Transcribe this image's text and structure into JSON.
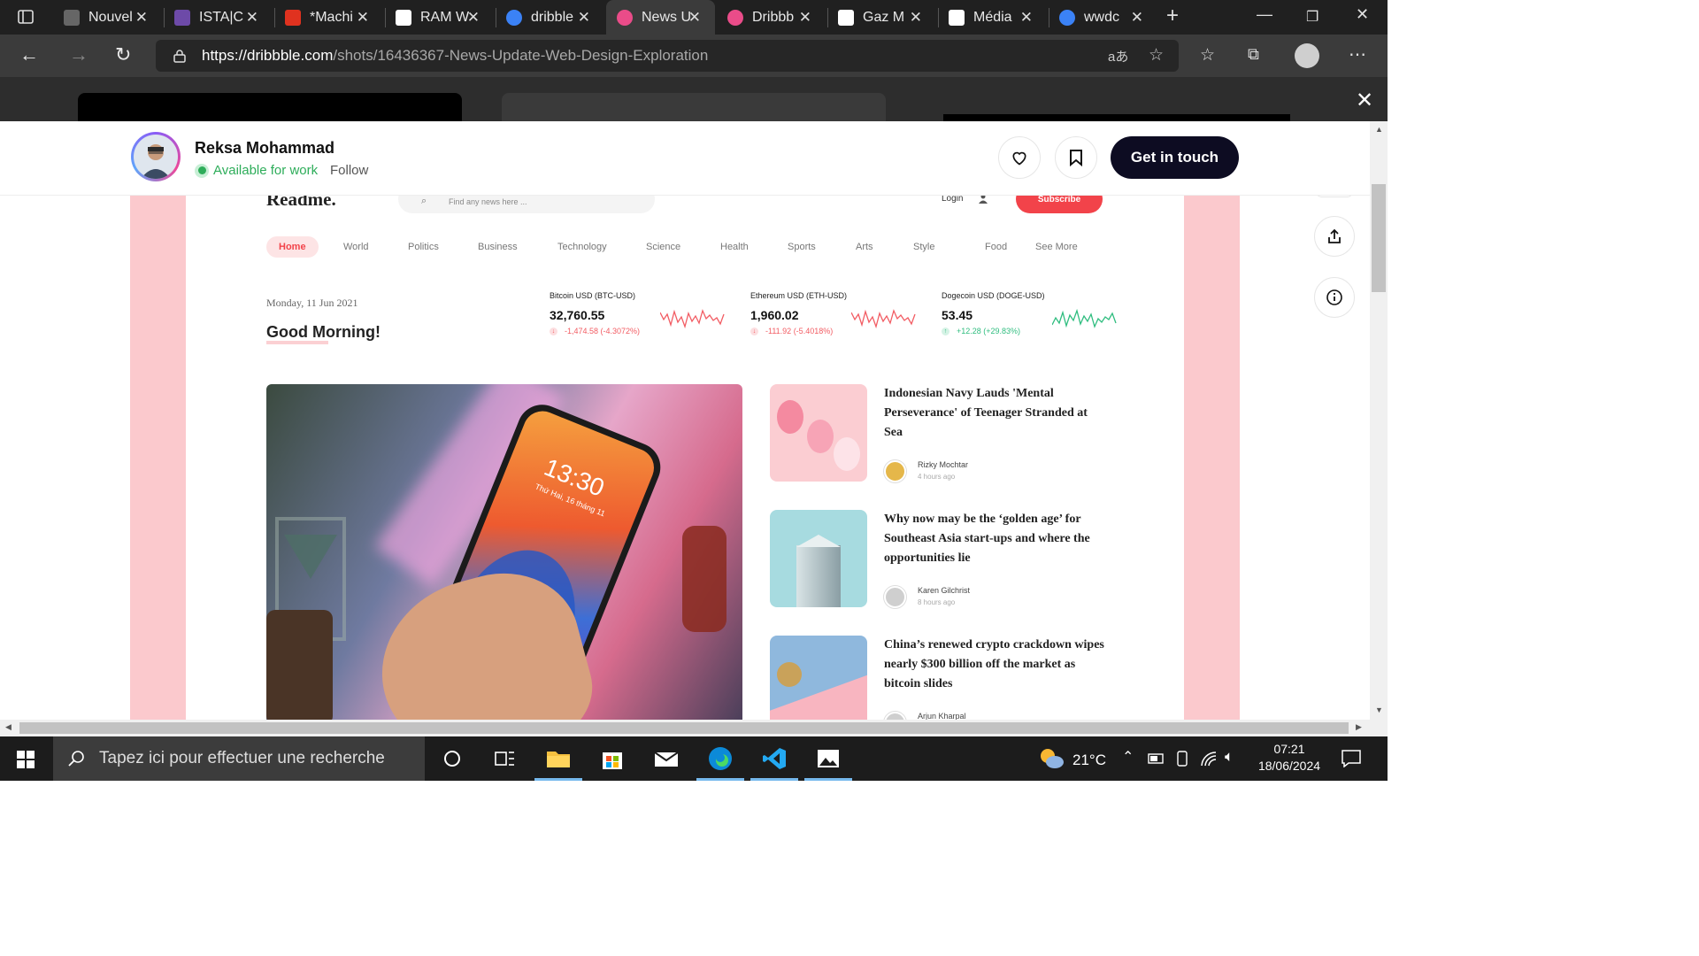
{
  "browser": {
    "tabs": [
      {
        "title": "Nouvel",
        "icon_color": "#666666",
        "icon": "new-tab-icon"
      },
      {
        "title": "ISTA|C",
        "icon_color": "#6d4aa8",
        "icon": "ista-icon"
      },
      {
        "title": "*Machi",
        "icon_color": "#e0321f",
        "icon": "pdf-icon"
      },
      {
        "title": "RAM W",
        "icon_color": "#ffffff",
        "icon": "ram-icon"
      },
      {
        "title": "dribble",
        "icon_color": "#3b82f6",
        "icon": "search-icon"
      },
      {
        "title": "News U",
        "icon_color": "#ea4c89",
        "icon": "dribbble-icon",
        "active": true
      },
      {
        "title": "Dribbb",
        "icon_color": "#ea4c89",
        "icon": "dribbble-icon"
      },
      {
        "title": "Gaz M",
        "icon_color": "#ffffff",
        "icon": "eye-icon"
      },
      {
        "title": "Média",
        "icon_color": "#ffffff",
        "icon": "eye-icon"
      },
      {
        "title": "wwdc",
        "icon_color": "#3b82f6",
        "icon": "search-icon"
      }
    ],
    "url_domain": "https://dribbble.com",
    "url_path": "/shots/16436367-News-Update-Web-Design-Exploration",
    "translate_glyph": "aあ"
  },
  "designer": {
    "name": "Reksa Mohammad",
    "availability": "Available for work",
    "follow": "Follow",
    "cta": "Get in touch"
  },
  "shot": {
    "logo": "Readme.",
    "search_placeholder": "Find any news here ...",
    "login": "Login",
    "subscribe": "Subscribe",
    "categories": [
      "Home",
      "World",
      "Politics",
      "Business",
      "Technology",
      "Science",
      "Health",
      "Sports",
      "Arts",
      "Style",
      "Food",
      "See More"
    ],
    "date": "Monday, 11 Jun 2021",
    "greeting": "Good Morning!",
    "crypto": [
      {
        "name": "Bitcoin USD (BTC-USD)",
        "price": "32,760.55",
        "change": "-1,474.58 (-4.3072%)",
        "trend": "down"
      },
      {
        "name": "Ethereum USD (ETH-USD)",
        "price": "1,960.02",
        "change": "-111.92 (-5.4018%)",
        "trend": "down"
      },
      {
        "name": "Dogecoin USD (DOGE-USD)",
        "price": "53.45",
        "change": "+12.28 (+29.83%)",
        "trend": "up"
      }
    ],
    "phone_time": "13:30",
    "phone_date": "Thứ Hai, 16 tháng 11",
    "articles": [
      {
        "title": "Indonesian Navy Lauds 'Mental Perseverance' of Teenager Stranded at Sea",
        "author": "Rizky Mochtar",
        "ago": "4 hours ago"
      },
      {
        "title": "Why now may be the ‘golden age’ for Southeast Asia start-ups and where the opportunities lie",
        "author": "Karen Gilchrist",
        "ago": "8 hours ago"
      },
      {
        "title": "China’s renewed crypto crackdown wipes nearly $300 billion off the market as bitcoin slides",
        "author": "Arjun Kharpal",
        "ago": ""
      }
    ],
    "colors": {
      "accent": "#f2434a",
      "up": "#2fbd7f",
      "down": "#f25c63",
      "side_panel": "#fbc9cd"
    }
  },
  "taskbar": {
    "search_placeholder": "Tapez ici pour effectuer une recherche",
    "weather": "21°C",
    "time": "07:21",
    "date": "18/06/2024"
  }
}
